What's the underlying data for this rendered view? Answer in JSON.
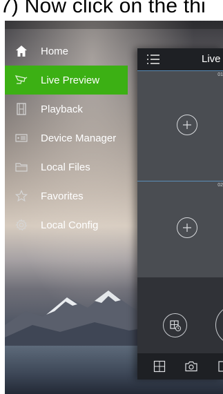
{
  "caption": {
    "text": "7) Now click on the thi"
  },
  "menu": {
    "items": [
      {
        "label": "Home",
        "icon": "home-icon",
        "active": false
      },
      {
        "label": "Live Preview",
        "icon": "camera-icon",
        "active": true
      },
      {
        "label": "Playback",
        "icon": "film-icon",
        "active": false
      },
      {
        "label": "Device Manager",
        "icon": "dvr-icon",
        "active": false
      },
      {
        "label": "Local Files",
        "icon": "folder-icon",
        "active": false
      },
      {
        "label": "Favorites",
        "icon": "star-icon",
        "active": false
      },
      {
        "label": "Local Config",
        "icon": "gear-icon",
        "active": false
      }
    ]
  },
  "panel": {
    "title": "Live",
    "cells": [
      {
        "tag": "01"
      },
      {
        "tag": "02"
      }
    ]
  },
  "colors": {
    "accent": "#3cb014",
    "panel_dark": "#1e2024"
  }
}
